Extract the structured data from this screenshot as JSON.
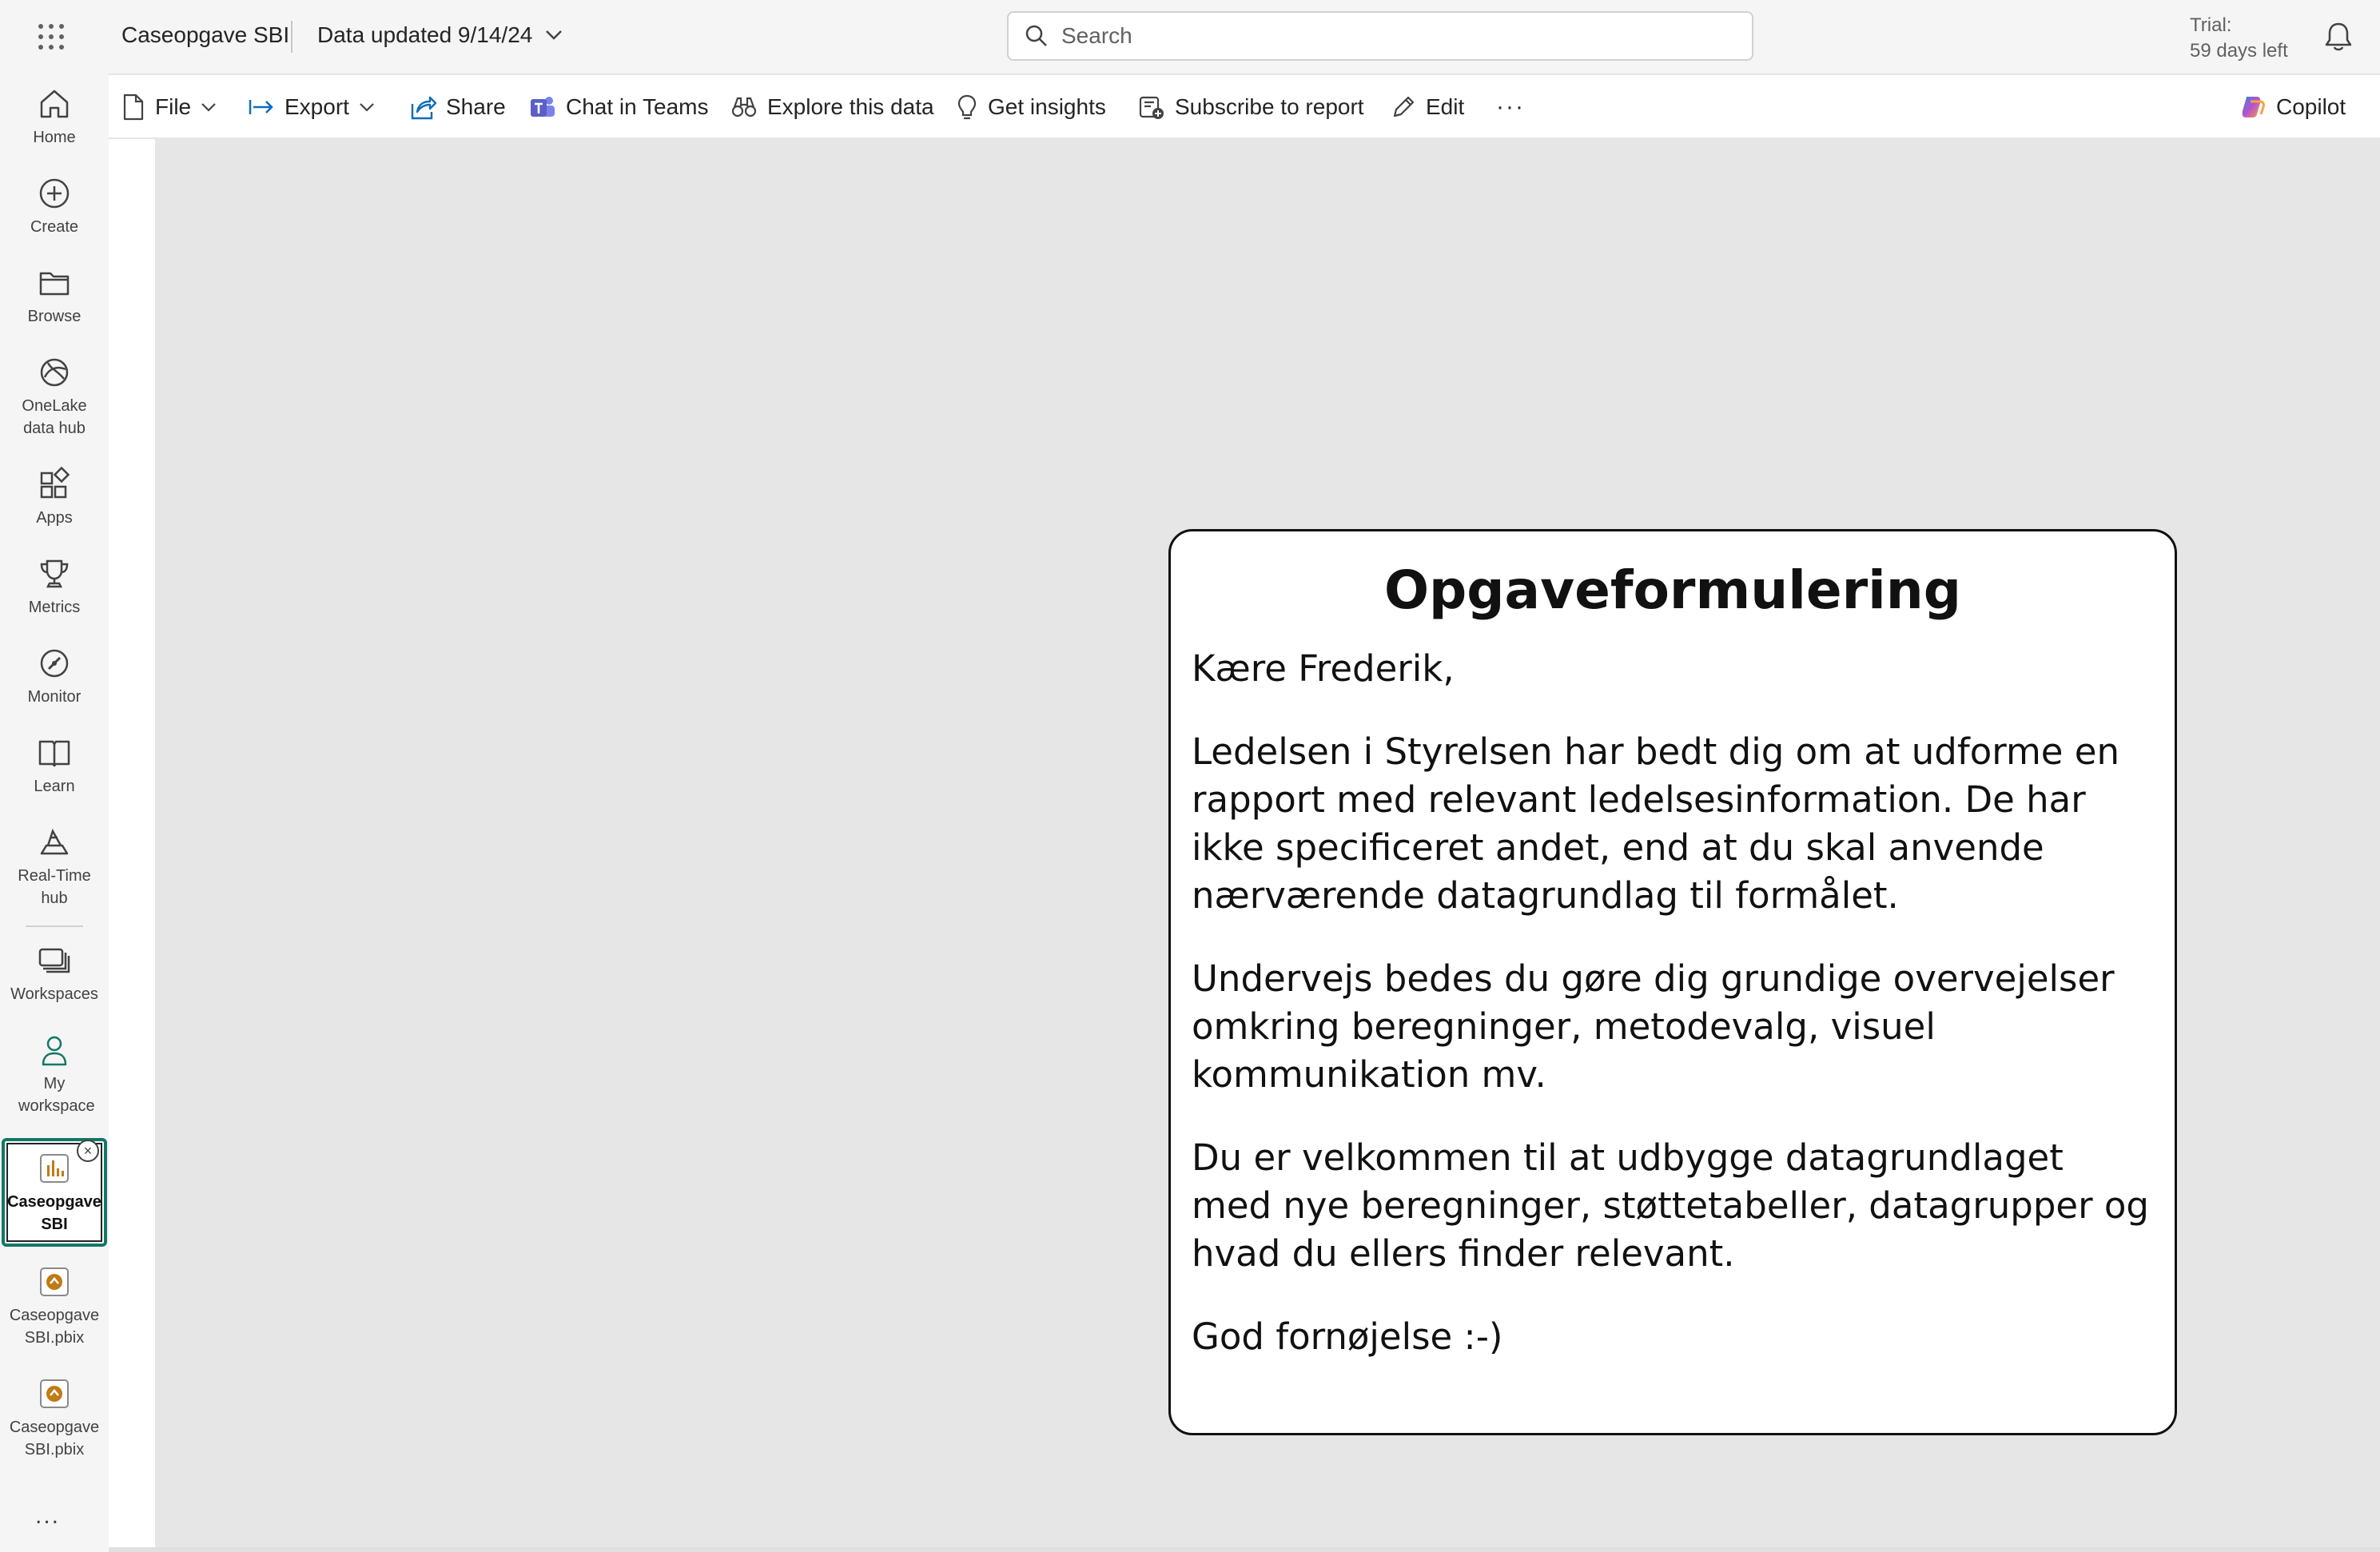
{
  "topbar": {
    "app_title": "Caseopgave SBI",
    "data_updated": "Data updated 9/14/24",
    "search_placeholder": "Search",
    "trial_line1": "Trial:",
    "trial_line2": "59 days left",
    "icons": [
      "app-launcher-icon",
      "chevron-down-icon",
      "search-icon",
      "bell-icon"
    ]
  },
  "sidebar": {
    "items": [
      {
        "label": "Home",
        "icon": "home-icon"
      },
      {
        "label": "Create",
        "icon": "plus-circle-icon"
      },
      {
        "label": "Browse",
        "icon": "folder-icon"
      },
      {
        "label": "OneLake data hub",
        "icon": "onelake-icon"
      },
      {
        "label": "Apps",
        "icon": "apps-icon"
      },
      {
        "label": "Metrics",
        "icon": "trophy-icon"
      },
      {
        "label": "Monitor",
        "icon": "monitor-icon"
      },
      {
        "label": "Learn",
        "icon": "book-icon"
      },
      {
        "label": "Real-Time hub",
        "icon": "realtime-icon"
      },
      {
        "label": "Workspaces",
        "icon": "workspaces-icon"
      },
      {
        "label": "My workspace",
        "icon": "person-icon"
      },
      {
        "label": "Caseopgave SBI",
        "icon": "report-icon"
      },
      {
        "label": "Caseopgave SBI.pbix",
        "icon": "pbix-icon"
      },
      {
        "label": "Caseopgave SBI.pbix",
        "icon": "pbix-icon"
      }
    ],
    "more": "..."
  },
  "toolbar": {
    "file": "File",
    "export": "Export",
    "share": "Share",
    "chat_in_teams": "Chat in Teams",
    "explore": "Explore this data",
    "insights": "Get insights",
    "subscribe": "Subscribe to report",
    "edit": "Edit",
    "more": "···",
    "copilot": "Copilot"
  },
  "report": {
    "title": "Opgaveformulering",
    "greeting": "Kære Frederik,",
    "paragraphs": [
      "Ledelsen i Styrelsen har bedt dig om at udforme en rapport med relevant ledelsesinformation. De har ikke specificeret andet, end at du skal anvende nærværende datagrundlag til formålet.",
      "Undervejs bedes du gøre dig grundige overvejelser omkring beregninger, metodevalg, visuel kommunikation mv.",
      "Du er velkommen til at udbygge datagrundlaget med nye beregninger, støttetabeller, datagrupper og hvad du ellers finder relevant.",
      "God fornøjelse :-)"
    ]
  },
  "colors": {
    "accent": "#117865",
    "teams": "#5b5fc7",
    "export_arrow": "#0f6cbd",
    "pbix": "#c17a16"
  }
}
